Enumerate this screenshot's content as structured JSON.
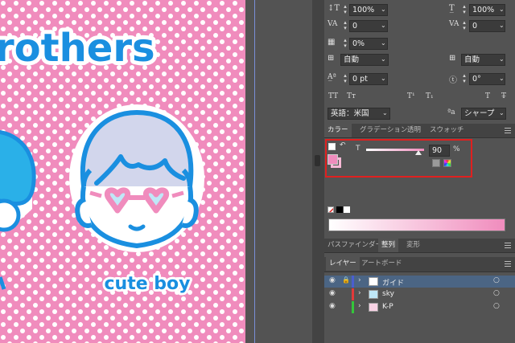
{
  "artwork": {
    "title_fragment": "rothers",
    "caption": "cute boy",
    "colors": {
      "background": "#f08cbd",
      "dot": "#ffffff",
      "outline": "#1a8fe0",
      "face_fill": "#ffffff",
      "hair": "#d2d6ec",
      "glasses": "#f08cbd",
      "lens": "#bfe7f7"
    }
  },
  "character": {
    "rows": [
      {
        "left_icon": "font-size-icon",
        "left_value": "100%",
        "right_icon": "vertical-scale-icon",
        "right_value": "100%"
      },
      {
        "left_icon": "kerning-icon",
        "left_value": "0",
        "right_icon": "tracking-icon",
        "right_value": "0"
      },
      {
        "left_icon": "tsume-icon",
        "left_value": "0%"
      },
      {
        "left_icon": "aki-left-icon",
        "left_value": "自動",
        "right_icon": "aki-right-icon",
        "right_value": "自動"
      },
      {
        "left_icon": "baseline-shift-icon",
        "left_value": "0 pt",
        "right_icon": "rotation-icon",
        "right_value": "0°"
      }
    ],
    "style_buttons": [
      "TT",
      "Tт",
      "T¹",
      "T₁",
      "T",
      "T̶"
    ],
    "language": "英語：米国",
    "antialias_icon_label": "ªa",
    "antialias": "シャープ"
  },
  "color_panel": {
    "tabs": [
      "カラー",
      "グラデーション",
      "透明",
      "スウォッチ"
    ],
    "active_tab": 0,
    "channel_label": "T",
    "tint_value": "90",
    "percent": "%",
    "fill_color": "#f08cbd",
    "stroke_color": "#f8b9d6",
    "ramp_start": "#ffffff",
    "ramp_end": "#f08cbd",
    "highlight_color": "#e0201f"
  },
  "bottom_tabs": [
    "パスファインダー",
    "整列",
    "変形"
  ],
  "bottom_active_tab": 1,
  "layers_panel": {
    "tabs": [
      "レイヤー",
      "アートボード"
    ],
    "active_tab": 0,
    "layers": [
      {
        "name": "ガイド",
        "color": "#4a5ed0",
        "locked": true,
        "selected": true
      },
      {
        "name": "sky",
        "color": "#e23a3a",
        "locked": false,
        "selected": false
      },
      {
        "name": "K-P",
        "color": "#34c63a",
        "locked": false,
        "selected": false
      }
    ]
  }
}
